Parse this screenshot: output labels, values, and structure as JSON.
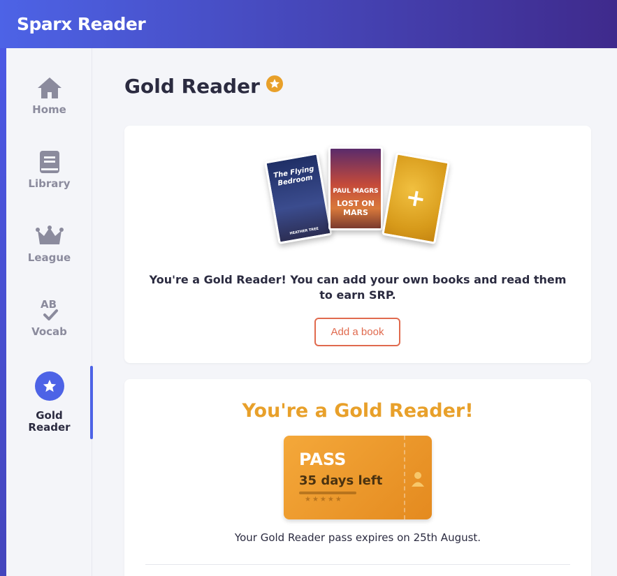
{
  "header": {
    "app_title": "Sparx Reader"
  },
  "sidebar": {
    "items": [
      {
        "label": "Home",
        "icon": "home-icon"
      },
      {
        "label": "Library",
        "icon": "book-icon"
      },
      {
        "label": "League",
        "icon": "crown-icon"
      },
      {
        "label": "Vocab",
        "icon": "vocab-check-icon",
        "icon_text": "AB"
      },
      {
        "label": "Gold\nReader",
        "icon": "star-icon",
        "active": true
      }
    ]
  },
  "main": {
    "page_title": "Gold Reader",
    "card1": {
      "books": [
        {
          "title": "The Flying Bedroom",
          "author": "HEATHER TREE"
        },
        {
          "title": "LOST ON MARS",
          "author": "PAUL MAGRS"
        },
        {
          "title": "add-book-placeholder"
        }
      ],
      "message": "You're a Gold Reader! You can add your own books and read them to earn SRP.",
      "add_button": "Add a book"
    },
    "card2": {
      "title": "You're a Gold Reader!",
      "pass_label": "PASS",
      "days_left": "35 days left",
      "expiry_text": "Your Gold Reader pass expires on 25th August."
    }
  },
  "colors": {
    "accent": "#4d63e6",
    "gold": "#e8a02a",
    "button": "#e06a4e",
    "text": "#2b2b40"
  }
}
